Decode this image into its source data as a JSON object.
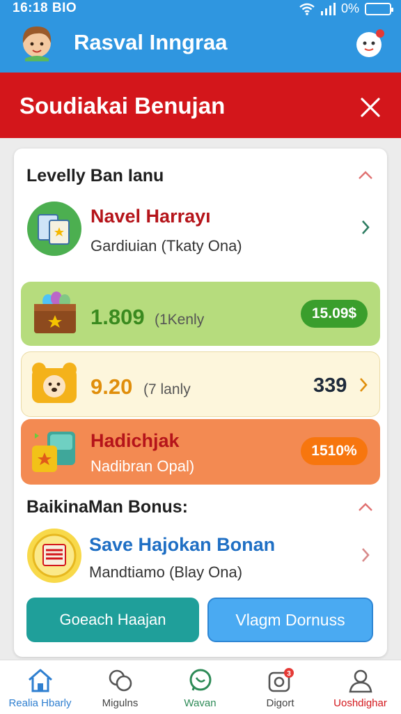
{
  "status_bar": {
    "time": "16:18 BIO",
    "battery_text": "0%"
  },
  "header": {
    "title": "Rasval Inngraa"
  },
  "banner": {
    "title": "Soudiakai Benujan"
  },
  "section1": {
    "title": "Levelly Ban Ianu",
    "item": {
      "title": "Navel Harrayı",
      "subtitle": "Gardiuian (Tkaty Ona)"
    }
  },
  "rows": [
    {
      "value": "1.809",
      "unit": "(1Kenly",
      "pill": "15.09$",
      "color": "#3aa832"
    },
    {
      "value": "9.20",
      "unit": "(7 lanly",
      "amount": "339",
      "color": "#e89a12"
    },
    {
      "value": "Hadichjak",
      "unit": "Nadibran Opal)",
      "pill": "1510%",
      "color": "#c51f15"
    }
  ],
  "section2": {
    "title": "BaikinaMan Bonus:",
    "item": {
      "title": "Save Hajokan Bonan",
      "subtitle": "Mandtiamo (Blay Ona)"
    }
  },
  "buttons": {
    "primary": "Goeach Haajan",
    "secondary": "Vlagm Dornuss"
  },
  "nav": [
    {
      "label": "Realia Hbarly",
      "icon": "home-icon"
    },
    {
      "label": "Migulns",
      "icon": "chat-icon"
    },
    {
      "label": "Wavan",
      "icon": "whatsapp-icon"
    },
    {
      "label": "Digort",
      "icon": "camera-icon",
      "badge": "3"
    },
    {
      "label": "Uoshdighar",
      "icon": "user-icon"
    }
  ],
  "colors": {
    "header": "#2f96e0",
    "banner": "#d3161b",
    "nav_active": "#2f7fd0",
    "nav_alert": "#d3161b"
  }
}
